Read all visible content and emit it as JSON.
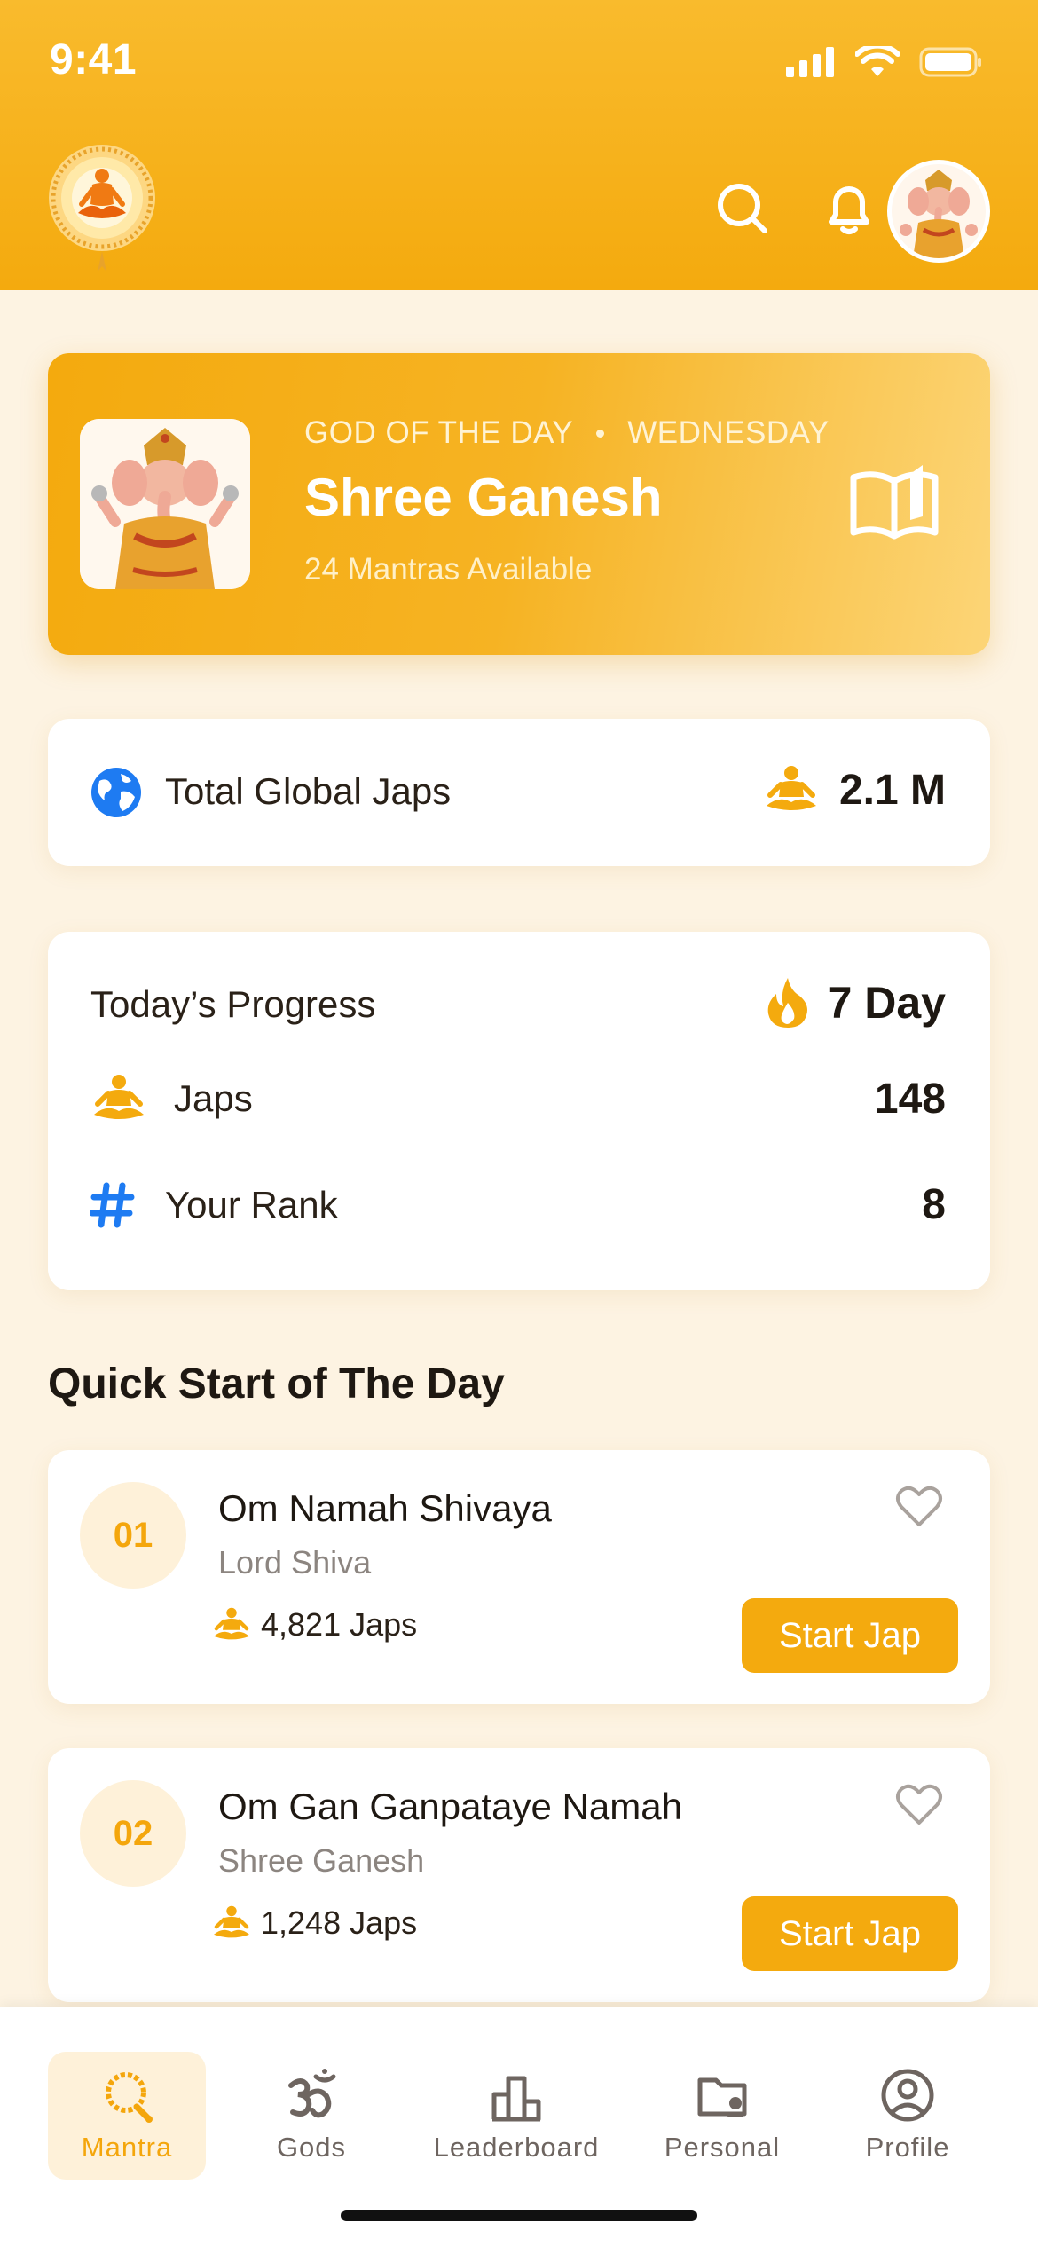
{
  "status_bar": {
    "time": "9:41"
  },
  "header": {
    "logo_icon": "meditation-logo-icon",
    "search_icon": "search-icon",
    "bell_icon": "bell-icon",
    "avatar_icon": "ganesh-avatar"
  },
  "god_of_day": {
    "eyebrow": "GOD OF THE DAY",
    "day": "WEDNESDAY",
    "name": "Shree Ganesh",
    "subtitle": "24 Mantras Available",
    "icon": "book-open-icon"
  },
  "global": {
    "label": "Total Global Japs",
    "value": "2.1 M",
    "icon": "globe-icon"
  },
  "progress": {
    "title": "Today’s Progress",
    "streak": "7 Day",
    "rows": [
      {
        "label": "Japs",
        "value": "148",
        "icon": "meditation-icon"
      },
      {
        "label": "Your Rank",
        "value": "8",
        "icon": "hash-icon"
      }
    ]
  },
  "quick_start": {
    "title": "Quick Start of The Day",
    "items": [
      {
        "num": "01",
        "title": "Om Namah Shivaya",
        "deity": "Lord Shiva",
        "count": "4,821 Japs",
        "button": "Start Jap"
      },
      {
        "num": "02",
        "title": "Om Gan Ganpataye Namah",
        "deity": "Shree Ganesh",
        "count": "1,248 Japs",
        "button": "Start Jap"
      }
    ]
  },
  "tabs": [
    {
      "label": "Mantra",
      "icon": "mala-icon",
      "active": true
    },
    {
      "label": "Gods",
      "icon": "om-icon",
      "active": false
    },
    {
      "label": "Leaderboard",
      "icon": "podium-icon",
      "active": false
    },
    {
      "label": "Personal",
      "icon": "folder-user-icon",
      "active": false
    },
    {
      "label": "Profile",
      "icon": "user-circle-icon",
      "active": false
    }
  ],
  "colors": {
    "accent": "#F4AA0E",
    "background": "#FDF3E2",
    "blue": "#1E7BF2"
  }
}
